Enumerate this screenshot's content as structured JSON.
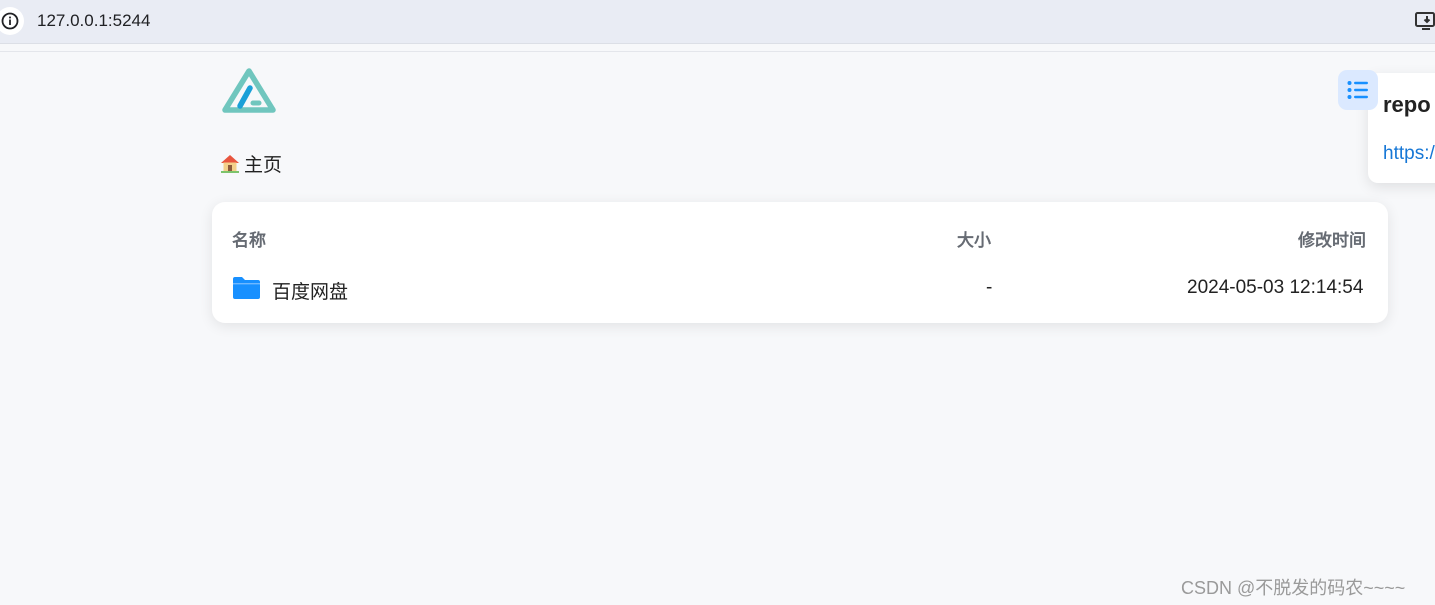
{
  "browser": {
    "url": "127.0.0.1:5244",
    "site_info_icon": "info-icon",
    "cast_icon": "cast-icon"
  },
  "app": {
    "logo": "alist-logo-icon",
    "accent_color": "#1890ff",
    "logo_colors": [
      "#70c6be",
      "#1ba0d8"
    ]
  },
  "breadcrumb": {
    "home_icon": "house-icon",
    "home_label": "主页"
  },
  "file_list": {
    "columns": {
      "name": "名称",
      "size": "大小",
      "modified": "修改时间"
    },
    "rows": [
      {
        "icon": "folder-icon",
        "name": "百度网盘",
        "size": "-",
        "modified": "2024-05-03 12:14:54"
      }
    ]
  },
  "toc": {
    "toggle_icon": "list-icon"
  },
  "readme_panel": {
    "title": "repo",
    "link": "https:/"
  },
  "watermark": "CSDN @不脱发的码农~~~~"
}
